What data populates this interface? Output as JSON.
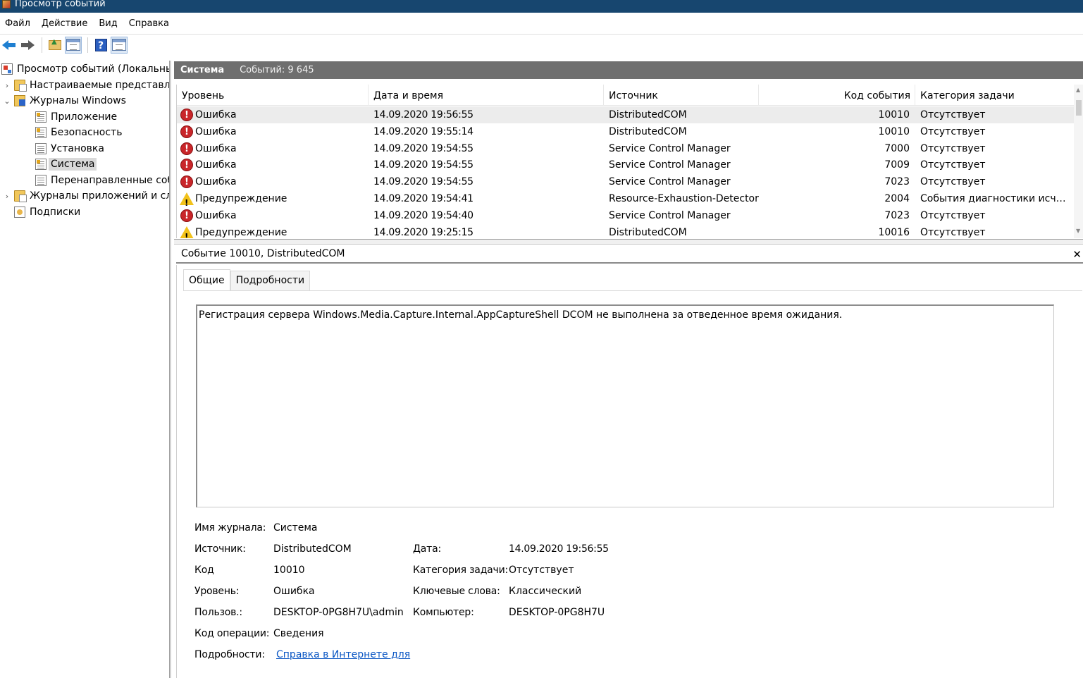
{
  "window": {
    "title": "Просмотр событий"
  },
  "menu": [
    "Файл",
    "Действие",
    "Вид",
    "Справка"
  ],
  "toolbar": {
    "icons": [
      "back-arrow-icon",
      "forward-arrow-icon",
      "folder-up-icon",
      "show-hide-console-tree-icon",
      "help-icon",
      "show-hide-action-pane-icon"
    ]
  },
  "tree": {
    "root": "Просмотр событий (Локальный",
    "custom_views": "Настраиваемые представлен",
    "windows_logs": "Журналы Windows",
    "application": "Приложение",
    "security": "Безопасность",
    "setup": "Установка",
    "system": "Система",
    "forwarded": "Перенаправленные собы",
    "app_service_logs": "Журналы приложений и слу",
    "subscriptions": "Подписки"
  },
  "list": {
    "title": "Система",
    "count": "Событий: 9 645",
    "columns": [
      "Уровень",
      "Дата и время",
      "Источник",
      "Код события",
      "Категория задачи"
    ],
    "rows": [
      {
        "level": "Ошибка",
        "type": "error",
        "date": "14.09.2020 19:56:55",
        "source": "DistributedCOM",
        "code": "10010",
        "category": "Отсутствует"
      },
      {
        "level": "Ошибка",
        "type": "error",
        "date": "14.09.2020 19:55:14",
        "source": "DistributedCOM",
        "code": "10010",
        "category": "Отсутствует"
      },
      {
        "level": "Ошибка",
        "type": "error",
        "date": "14.09.2020 19:54:55",
        "source": "Service Control Manager",
        "code": "7000",
        "category": "Отсутствует"
      },
      {
        "level": "Ошибка",
        "type": "error",
        "date": "14.09.2020 19:54:55",
        "source": "Service Control Manager",
        "code": "7009",
        "category": "Отсутствует"
      },
      {
        "level": "Ошибка",
        "type": "error",
        "date": "14.09.2020 19:54:55",
        "source": "Service Control Manager",
        "code": "7023",
        "category": "Отсутствует"
      },
      {
        "level": "Предупреждение",
        "type": "warning",
        "date": "14.09.2020 19:54:41",
        "source": "Resource-Exhaustion-Detector",
        "code": "2004",
        "category": "События диагностики исчерп..."
      },
      {
        "level": "Ошибка",
        "type": "error",
        "date": "14.09.2020 19:54:40",
        "source": "Service Control Manager",
        "code": "7023",
        "category": "Отсутствует"
      },
      {
        "level": "Предупреждение",
        "type": "warning",
        "date": "14.09.2020 19:25:15",
        "source": "DistributedCOM",
        "code": "10016",
        "category": "Отсутствует"
      }
    ]
  },
  "detail": {
    "title": "Событие 10010, DistributedCOM",
    "tabs": [
      "Общие",
      "Подробности"
    ],
    "message": "Регистрация сервера Windows.Media.Capture.Internal.AppCaptureShell DCOM не выполнена за отведенное время ожидания.",
    "labels": {
      "log_name": "Имя журнала:",
      "source": "Источник:",
      "date": "Дата:",
      "code": "Код",
      "category": "Категория задачи:",
      "level": "Уровень:",
      "keywords": "Ключевые слова:",
      "user": "Пользов.:",
      "computer": "Компьютер:",
      "opcode": "Код операции:",
      "more_info": "Подробности:"
    },
    "values": {
      "log_name": "Система",
      "source": "DistributedCOM",
      "date": "14.09.2020 19:56:55",
      "code": "10010",
      "category": "Отсутствует",
      "level": "Ошибка",
      "keywords": "Классический",
      "user": "DESKTOP-0PG8H7U\\admin",
      "computer": "DESKTOP-0PG8H7U",
      "opcode": "Сведения",
      "more_info": "Справка в Интернете для "
    }
  }
}
